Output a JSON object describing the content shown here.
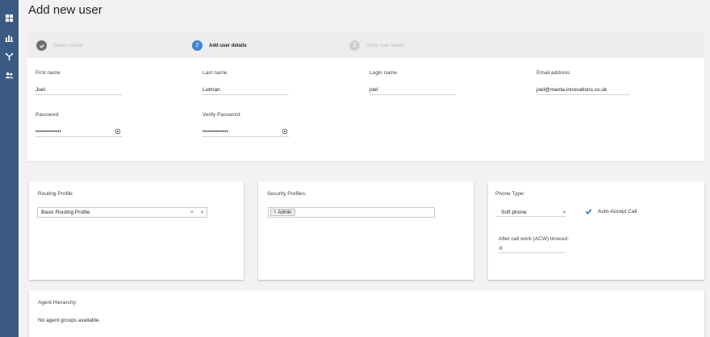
{
  "page": {
    "title": "Add new user"
  },
  "sidebar": {
    "items": [
      {
        "icon": "dashboard-icon"
      },
      {
        "icon": "bar-chart-icon"
      },
      {
        "icon": "routing-icon"
      },
      {
        "icon": "users-icon"
      }
    ]
  },
  "steps": [
    {
      "number": "",
      "label": "Select source",
      "state": "complete"
    },
    {
      "number": "2",
      "label": "Add user details",
      "state": "active"
    },
    {
      "number": "3",
      "label": "Verify user details",
      "state": "pending"
    }
  ],
  "details": {
    "first_name": {
      "label": "First name",
      "value": "Joel"
    },
    "last_name": {
      "label": "Last name",
      "value": "Lutman"
    },
    "login_name": {
      "label": "Login name",
      "value": "joel"
    },
    "email": {
      "label": "Email address",
      "value": "joel@manta-innovations.co.uk"
    },
    "password": {
      "label": "Password",
      "value": "••••••••••••••"
    },
    "verify_password": {
      "label": "Verify Password",
      "value": "••••••••••••••"
    }
  },
  "routing": {
    "title": "Routing Profile:",
    "selected": "Basic Routing Profile",
    "clear": "×",
    "caret": "▾"
  },
  "security": {
    "title": "Security Profiles:",
    "tags": [
      "Admin"
    ],
    "tag_remove": "×"
  },
  "phone": {
    "title": "Phone Type:",
    "selected": "Soft phone",
    "caret": "▾",
    "auto_accept_label": "Auto-Accept Call",
    "auto_accept_checked": true,
    "acw_label": "After call work (ACW) timeout:",
    "acw_value": "0"
  },
  "hierarchy": {
    "title": "Agent Hierarchy:",
    "message": "No agent groups available."
  }
}
